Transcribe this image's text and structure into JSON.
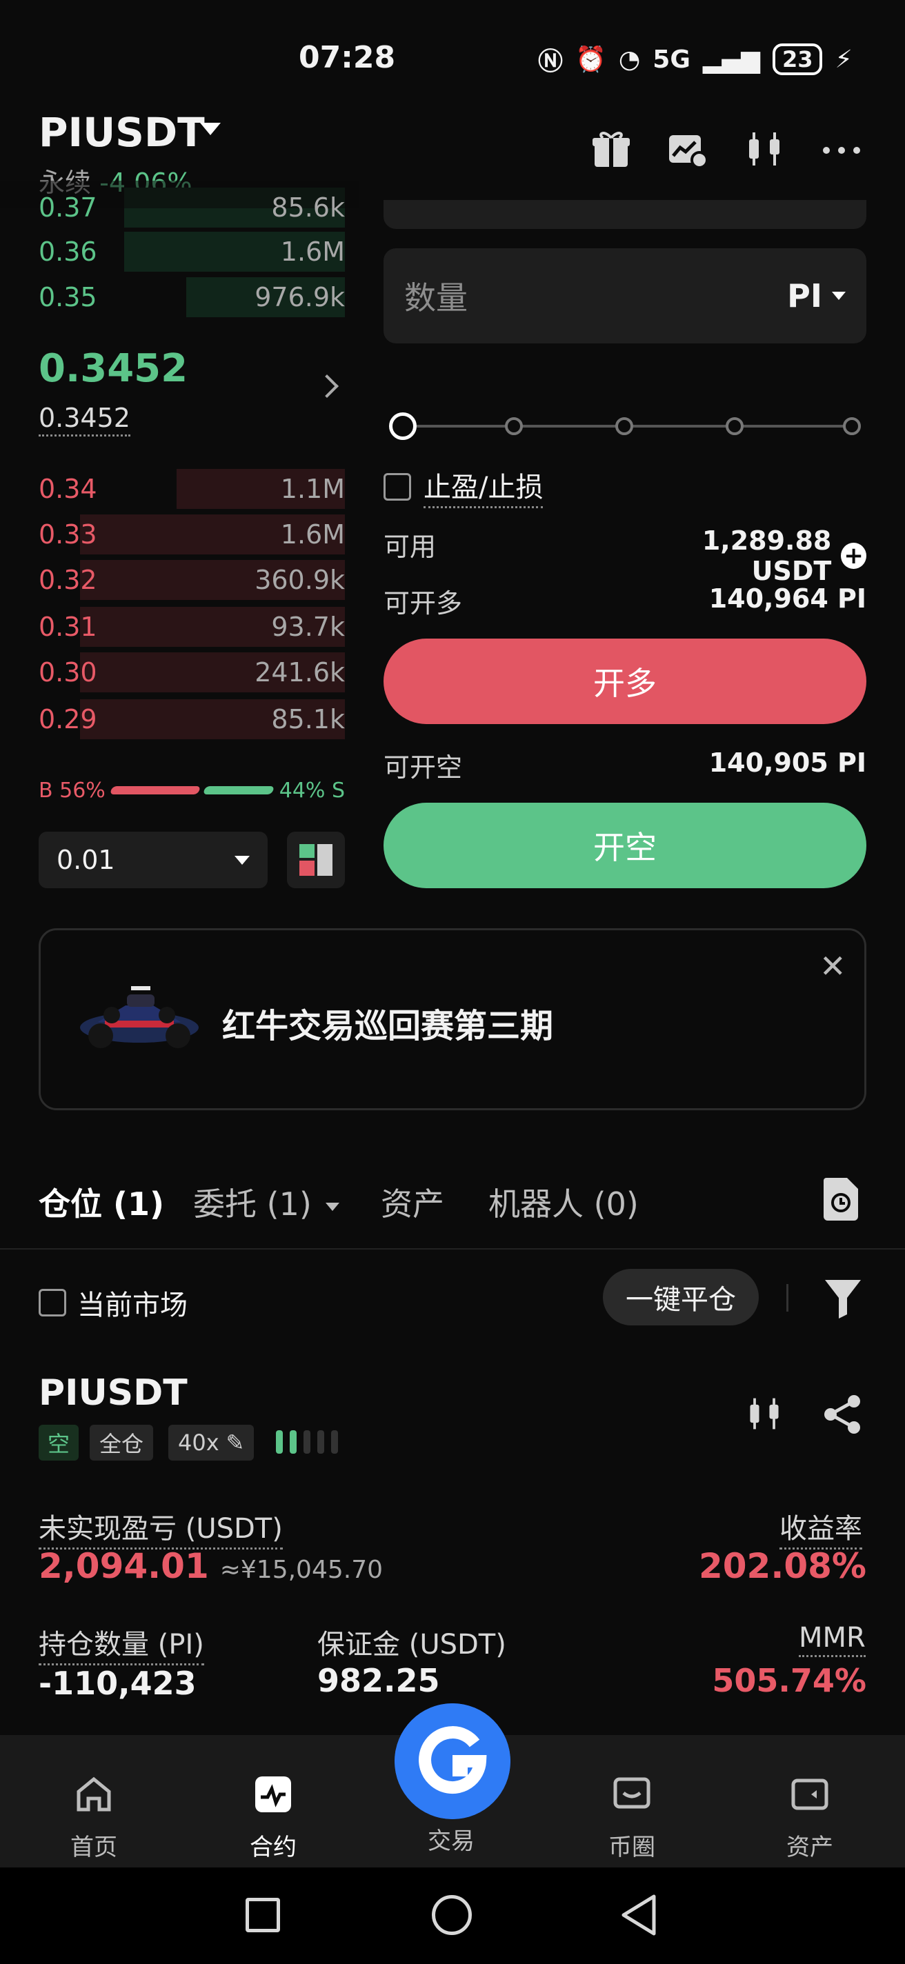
{
  "status_bar": {
    "time": "07:28",
    "network": "5G",
    "battery": "23"
  },
  "header": {
    "pair": "PIUSDT",
    "contract_type": "永续",
    "change": "-4.06%"
  },
  "order_book": {
    "asks_top": [
      {
        "price": "0.37",
        "size": "85.6k"
      },
      {
        "price": "0.36",
        "size": "1.6M"
      },
      {
        "price": "0.35",
        "size": "976.9k"
      }
    ],
    "last_price": "0.3452",
    "mark_price": "0.3452",
    "bids": [
      {
        "price": "0.34",
        "size": "1.1M"
      },
      {
        "price": "0.33",
        "size": "1.6M"
      },
      {
        "price": "0.32",
        "size": "360.9k"
      },
      {
        "price": "0.31",
        "size": "93.7k"
      },
      {
        "price": "0.30",
        "size": "241.6k"
      },
      {
        "price": "0.29",
        "size": "85.1k"
      }
    ],
    "buy_ratio_label": "B 56%",
    "sell_ratio_label": "44% S",
    "buy_ratio": 0.56,
    "precision": "0.01"
  },
  "order_form": {
    "quantity_placeholder": "数量",
    "quantity_unit": "PI",
    "slider_percent": 0,
    "tp_sl_label": "止盈/止损",
    "available_label": "可用",
    "available_value": "1,289.88 USDT",
    "can_long_label": "可开多",
    "can_long_value": "140,964 PI",
    "long_button": "开多",
    "can_short_label": "可开空",
    "can_short_value": "140,905 PI",
    "short_button": "开空"
  },
  "banner": {
    "text": "红牛交易巡回赛第三期"
  },
  "tabs": {
    "positions": "仓位 (1)",
    "orders": "委托 (1)",
    "assets": "资产",
    "bots": "机器人 (0)"
  },
  "positions_toolbar": {
    "current_market": "当前市场",
    "close_all": "一键平仓"
  },
  "position": {
    "symbol": "PIUSDT",
    "side": "空",
    "margin_mode": "全仓",
    "leverage": "40x",
    "unrealized_label": "未实现盈亏 (USDT)",
    "unrealized_value": "2,094.01",
    "unrealized_cny": "≈¥15,045.70",
    "roe_label": "收益率",
    "roe_value": "202.08%",
    "qty_label": "持仓数量 (PI)",
    "qty_value": "-110,423",
    "margin_label": "保证金 (USDT)",
    "margin_value": "982.25",
    "mmr_label": "MMR",
    "mmr_value": "505.74%"
  },
  "bottom_nav": {
    "home": "首页",
    "futures": "合约",
    "trade": "交易",
    "circle": "币圈",
    "assets": "资产"
  },
  "colors": {
    "green": "#5cc489",
    "red": "#e25663",
    "accent": "#2f7bf5"
  }
}
